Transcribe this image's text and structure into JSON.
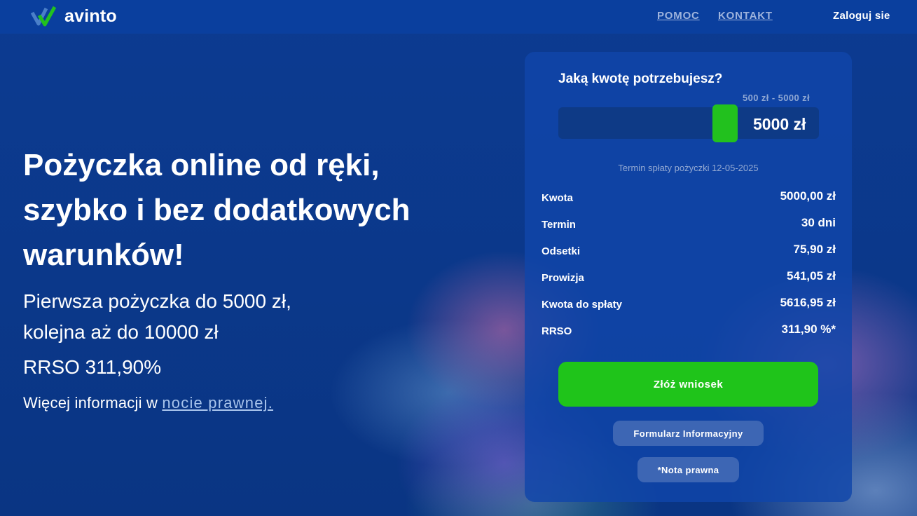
{
  "header": {
    "logo_text": "avinto",
    "nav": [
      "POMOC",
      "KONTAKT"
    ],
    "login": "Zaloguj sie"
  },
  "hero": {
    "title_lines": [
      "Pożyczka online od ręki,",
      "szybko i bez dodatkowych",
      "warunków!"
    ],
    "subtitle_lines": [
      "Pierwsza pożyczka do 5000 zł,",
      "kolejna aż do 10000 zł"
    ],
    "rrso": "RRSO 311,90%",
    "more_prefix": "Więcej informacji w ",
    "more_link": "nocie prawnej."
  },
  "calculator": {
    "question": "Jaką kwotę potrzebujesz?",
    "range_hint": "500 zł - 5000 zł",
    "amount_display": "5000 zł",
    "slider_level": 1.0,
    "term_note": "Termin spłaty pożyczki 12-05-2025",
    "rows": [
      {
        "label": "Kwota",
        "value": "5000,00 zł"
      },
      {
        "label": "Termin",
        "value": "30 dni"
      },
      {
        "label": "Odsetki",
        "value": "75,90 zł"
      },
      {
        "label": "Prowizja",
        "value": "541,05 zł"
      },
      {
        "label": "Kwota do spłaty",
        "value": "5616,95 zł"
      },
      {
        "label": "RRSO",
        "value": "311,90 %*"
      }
    ],
    "submit_label": "Złóż wniosek",
    "form_label": "Formularz Informacyjny",
    "note_label": "*Nota prawna"
  },
  "colors": {
    "background": "#0b3a8c",
    "accent_green": "#1fc41a",
    "card": "#1046aa"
  }
}
